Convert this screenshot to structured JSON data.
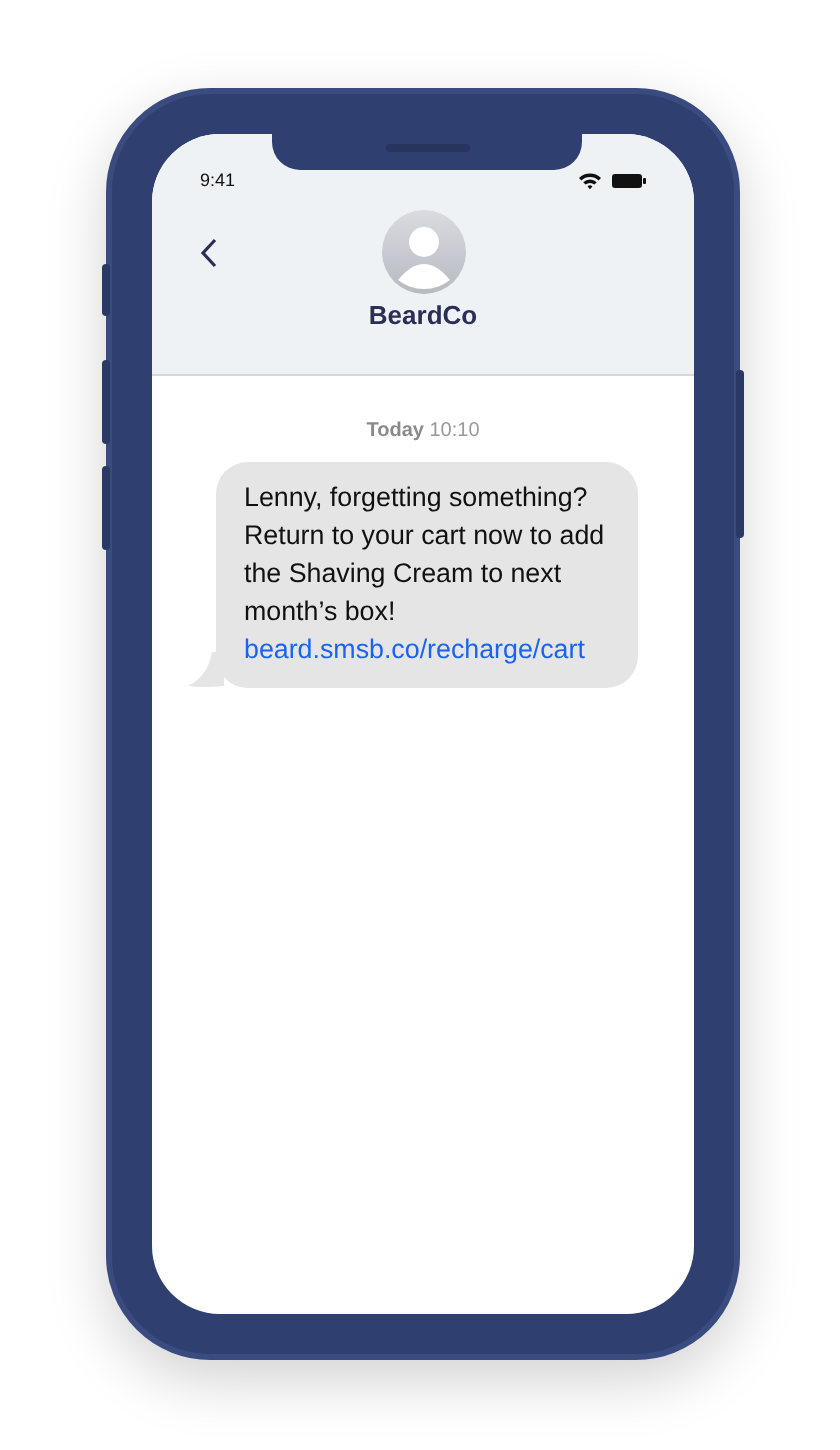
{
  "status_bar": {
    "time": "9:41"
  },
  "header": {
    "contact_name": "BeardCo"
  },
  "messages": [
    {
      "timestamp": "**Today** 10:10",
      "text": "Lenny, forgetting something? Return to your cart now to add the Shaving Cream to next month’s box!",
      "link": "beard.smsb.co/recharge/cart"
    }
  ]
}
